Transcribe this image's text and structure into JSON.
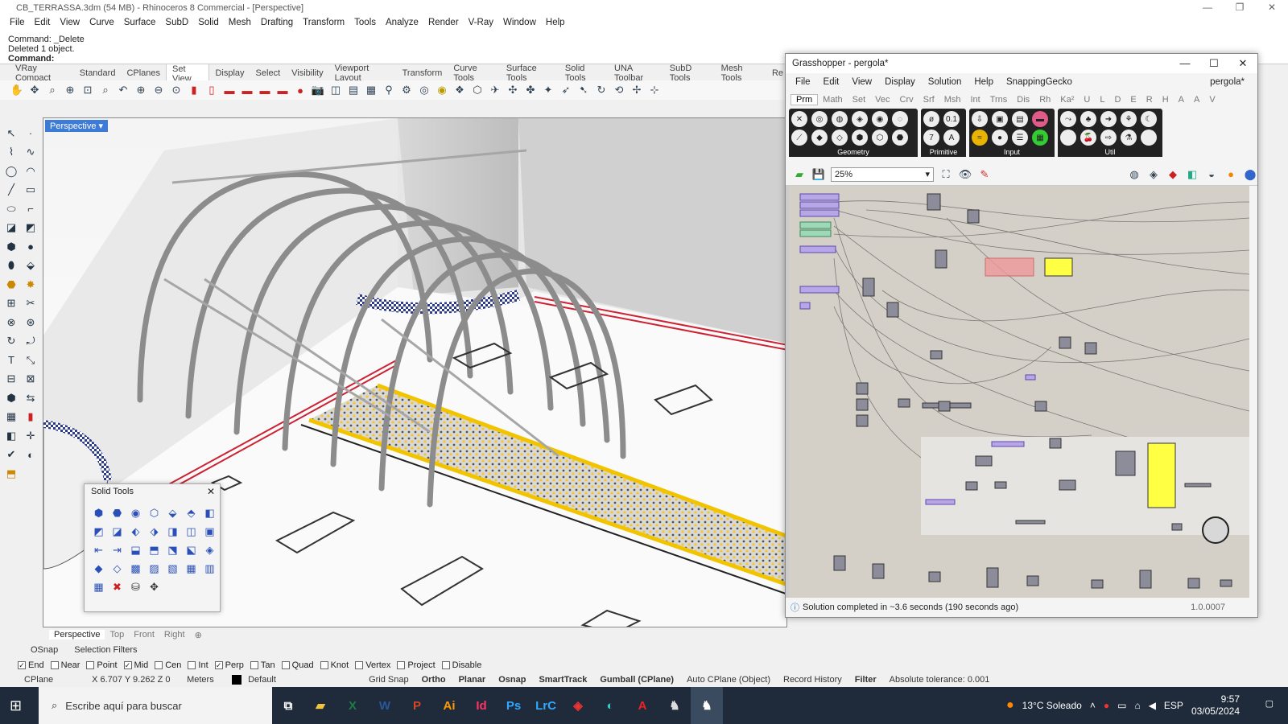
{
  "window": {
    "title": "CB_TERRASSA.3dm (54 MB) - Rhinoceros 8 Commercial - [Perspective]"
  },
  "menubar": [
    "File",
    "Edit",
    "View",
    "Curve",
    "Surface",
    "SubD",
    "Solid",
    "Mesh",
    "Drafting",
    "Transform",
    "Tools",
    "Analyze",
    "Render",
    "V-Ray",
    "Window",
    "Help"
  ],
  "command": {
    "line1": "Command: _Delete",
    "line2": "Deleted 1 object.",
    "prompt": "Command:"
  },
  "toolbar_tabs": [
    "VRay Compact",
    "Standard",
    "CPlanes",
    "Set View",
    "Display",
    "Select",
    "Visibility",
    "Viewport Layout",
    "Transform",
    "Curve Tools",
    "Surface Tools",
    "Solid Tools",
    "UNA Toolbar",
    "SubD Tools",
    "Mesh Tools",
    "Re"
  ],
  "toolbar_active_tab": "Set View",
  "viewport": {
    "label": "Perspective"
  },
  "view_tabs": [
    "Perspective",
    "Top",
    "Front",
    "Right"
  ],
  "solid_tools_panel": {
    "title": "Solid Tools"
  },
  "osnap_tabs": [
    "OSnap",
    "Selection Filters"
  ],
  "osnaps": [
    {
      "label": "End",
      "checked": true
    },
    {
      "label": "Near",
      "checked": false
    },
    {
      "label": "Point",
      "checked": false
    },
    {
      "label": "Mid",
      "checked": true
    },
    {
      "label": "Cen",
      "checked": false
    },
    {
      "label": "Int",
      "checked": false
    },
    {
      "label": "Perp",
      "checked": true
    },
    {
      "label": "Tan",
      "checked": false
    },
    {
      "label": "Quad",
      "checked": false
    },
    {
      "label": "Knot",
      "checked": false
    },
    {
      "label": "Vertex",
      "checked": false
    },
    {
      "label": "Project",
      "checked": false
    },
    {
      "label": "Disable",
      "checked": false
    }
  ],
  "status": {
    "cplane": "CPlane",
    "coords": "X 6.707 Y 9.262 Z 0",
    "units": "Meters",
    "layer": "Default",
    "grid_snap": "Grid Snap",
    "ortho": "Ortho",
    "planar": "Planar",
    "osnap": "Osnap",
    "smarttrack": "SmartTrack",
    "gumball": "Gumball (CPlane)",
    "autocplane": "Auto CPlane (Object)",
    "record_history": "Record History",
    "filter": "Filter",
    "tolerance": "Absolute tolerance: 0.001"
  },
  "grasshopper": {
    "title": "Grasshopper - pergola*",
    "menu": [
      "File",
      "Edit",
      "View",
      "Display",
      "Solution",
      "Help",
      "SnappingGecko"
    ],
    "doc_name": "pergola*",
    "tabs": [
      "Prm",
      "Math",
      "Set",
      "Vec",
      "Crv",
      "Srf",
      "Msh",
      "Int",
      "Trns",
      "Dis",
      "Rh",
      "Ka²",
      "U",
      "L",
      "D",
      "E",
      "R",
      "H",
      "A",
      "A",
      "V"
    ],
    "active_tab": "Prm",
    "groups": [
      "Geometry",
      "Primitive",
      "Input",
      "Util"
    ],
    "zoom": "25%",
    "status": "Solution completed in ~3.6 seconds (190 seconds ago)",
    "version": "1.0.0007"
  },
  "taskbar": {
    "search_placeholder": "Escribe aquí para buscar",
    "weather": "13°C Soleado",
    "lang": "ESP",
    "time": "9:57",
    "date": "03/05/2024"
  }
}
